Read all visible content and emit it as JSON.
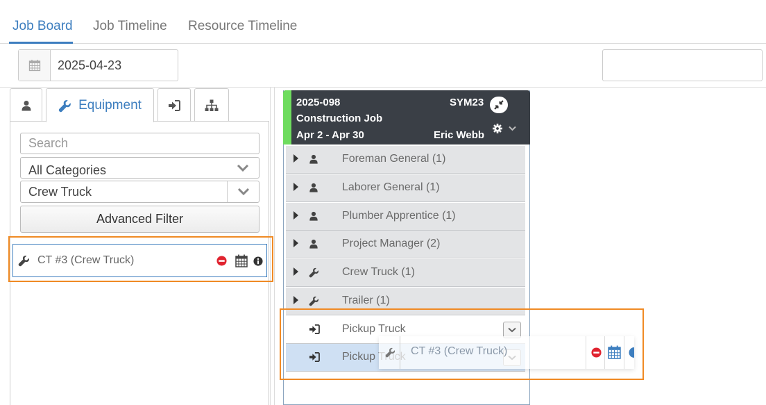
{
  "tabs": {
    "job_board": "Job Board",
    "job_timeline": "Job Timeline",
    "resource_timeline": "Resource Timeline"
  },
  "date_filter": {
    "value": "2025-04-23"
  },
  "left_panel": {
    "active_tab": "Equipment",
    "tab_icons": [
      "user-icon",
      "wrench-icon",
      "sign-in-icon",
      "sitemap-icon"
    ],
    "search": {
      "placeholder": "Search"
    },
    "category_select": {
      "value": "All Categories"
    },
    "type_select": {
      "value": "Crew Truck"
    },
    "advanced_filter_label": "Advanced Filter",
    "items": [
      {
        "label": "CT #3 (Crew Truck)",
        "icons": [
          "wrench-icon",
          "remove-icon",
          "calendar-icon",
          "info-icon"
        ]
      }
    ]
  },
  "job_card": {
    "number": "2025-098",
    "name": "Construction Job",
    "dates": "Apr 2 - Apr 30",
    "code": "SYM23",
    "manager": "Eric Webb",
    "rows": [
      {
        "label": "Foreman General (1)",
        "icon": "user-icon"
      },
      {
        "label": "Laborer General (1)",
        "icon": "user-icon"
      },
      {
        "label": "Plumber Apprentice (1)",
        "icon": "user-icon"
      },
      {
        "label": "Project Manager (2)",
        "icon": "user-icon"
      },
      {
        "label": "Crew Truck (1)",
        "icon": "wrench-icon"
      },
      {
        "label": "Trailer (1)",
        "icon": "wrench-icon"
      },
      {
        "label": "Pickup Truck",
        "icon": "sign-in-icon"
      },
      {
        "label": "Pickup Truck",
        "icon": "sign-in-icon"
      }
    ]
  },
  "drag_ghost": {
    "label": "CT #3 (Crew Truck)"
  },
  "colors": {
    "accent": "#3d7ebf",
    "highlight": "#f08a24",
    "job_status": "#6edc5e",
    "header_bg": "#3a3f46",
    "remove": "#e0232f"
  }
}
